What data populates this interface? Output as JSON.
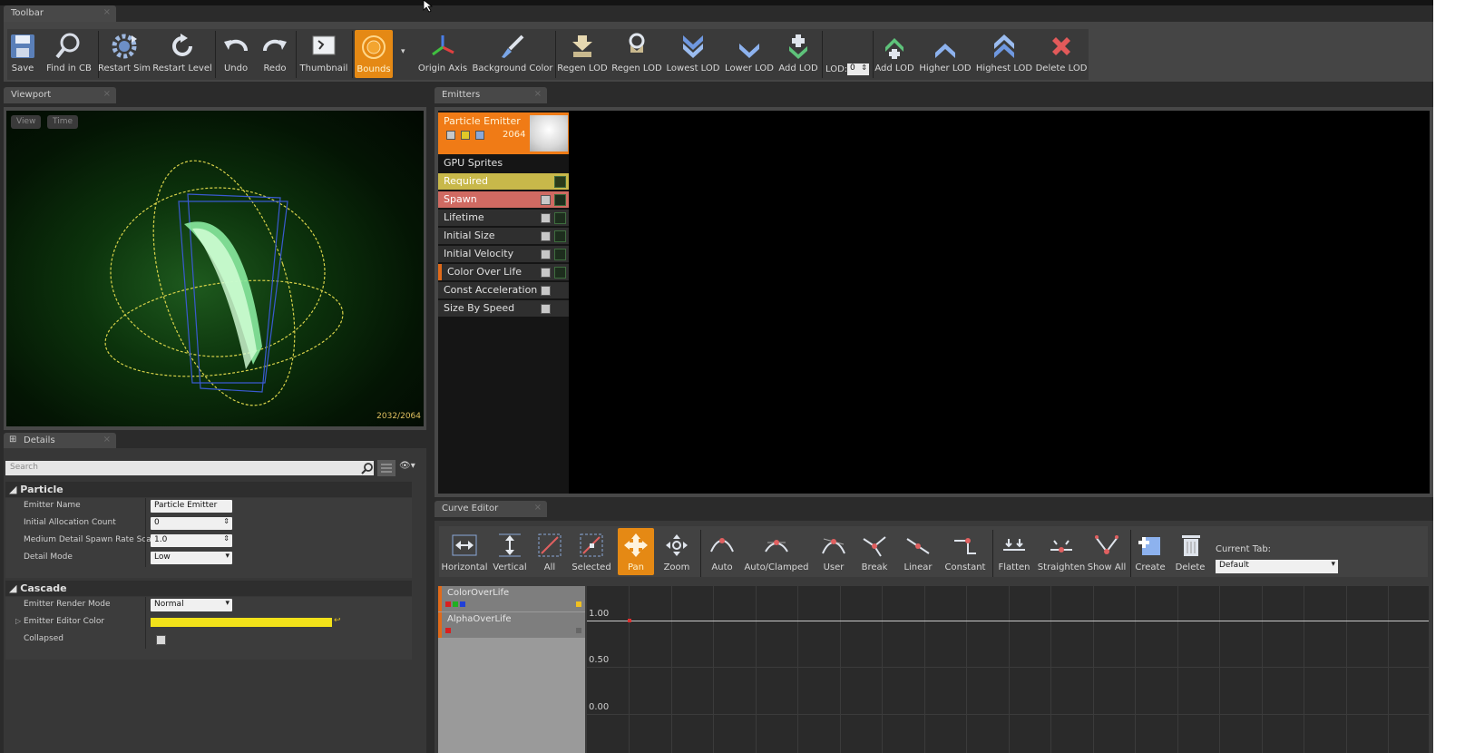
{
  "toolbar": {
    "tab": "Toolbar",
    "buttons": {
      "save": "Save",
      "find_in_cb": "Find in CB",
      "restart_sim": "Restart Sim",
      "restart_level": "Restart Level",
      "undo": "Undo",
      "redo": "Redo",
      "thumbnail": "Thumbnail",
      "bounds": "Bounds",
      "origin_axis": "Origin Axis",
      "background_color": "Background Color",
      "regen_lod_1": "Regen LOD",
      "regen_lod_2": "Regen LOD",
      "lowest_lod": "Lowest LOD",
      "lower_lod": "Lower LOD",
      "add_lod_1": "Add LOD",
      "lod_label": "LOD:",
      "lod_value": "0",
      "add_lod_2": "Add LOD",
      "higher_lod": "Higher LOD",
      "highest_lod": "Highest LOD",
      "delete_lod": "Delete LOD"
    }
  },
  "viewport": {
    "tab": "Viewport",
    "view_button": "View",
    "time_button": "Time",
    "particle_count": "2032/2064"
  },
  "details": {
    "tab": "Details",
    "search_placeholder": "Search",
    "particle_section": "Particle",
    "particle_rows": [
      {
        "label": "Emitter Name",
        "value": "Particle Emitter"
      },
      {
        "label": "Initial Allocation Count",
        "value": "0"
      },
      {
        "label": "Medium Detail Spawn Rate Scale",
        "value": "1.0"
      },
      {
        "label": "Detail Mode",
        "value": "Low"
      }
    ],
    "cascade_section": "Cascade",
    "cascade_rows": [
      {
        "label": "Emitter Render Mode",
        "value": "Normal"
      },
      {
        "label": "Emitter Editor Color",
        "value": ""
      },
      {
        "label": "Collapsed",
        "value": ""
      }
    ],
    "editor_color": "#f2e21a"
  },
  "emitters": {
    "tab": "Emitters",
    "emitter_name": "Particle Emitter",
    "emitter_count": "2064",
    "type": "GPU Sprites",
    "modules": [
      "Required",
      "Spawn",
      "Lifetime",
      "Initial Size",
      "Initial Velocity",
      "Color Over Life",
      "Const Acceleration",
      "Size By Speed"
    ],
    "colors": {
      "required": "#c8b84a",
      "spawn": "#d06a62",
      "header": "#f07b16"
    }
  },
  "curve_editor": {
    "tab": "Curve Editor",
    "buttons": {
      "horizontal": "Horizontal",
      "vertical": "Vertical",
      "all": "All",
      "selected": "Selected",
      "pan": "Pan",
      "zoom": "Zoom",
      "auto": "Auto",
      "auto_clamped": "Auto/Clamped",
      "user": "User",
      "break": "Break",
      "linear": "Linear",
      "constant": "Constant",
      "flatten": "Flatten",
      "straighten": "Straighten",
      "show_all": "Show All",
      "create": "Create",
      "delete": "Delete"
    },
    "current_tab_label": "Current Tab:",
    "current_tab_value": "Default",
    "curves": [
      "ColorOverLife",
      "AlphaOverLife"
    ],
    "y_labels": [
      "1.00",
      "0.50",
      "0.00"
    ]
  }
}
